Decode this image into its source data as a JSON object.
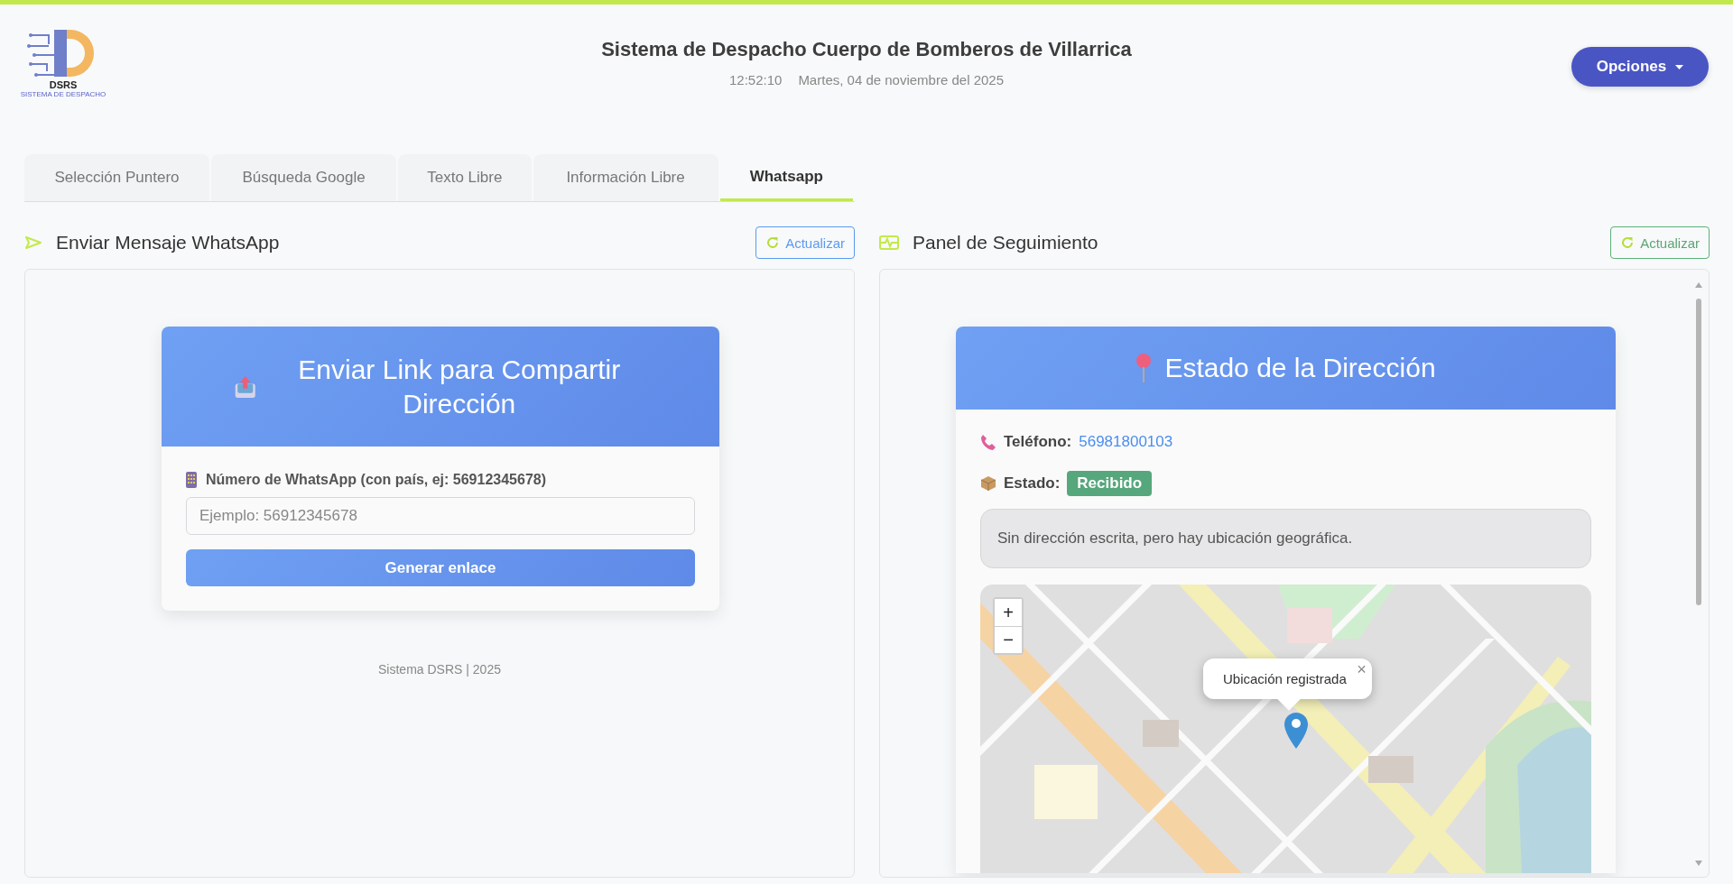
{
  "header": {
    "logo_text": "DSRS",
    "logo_subtitle": "SISTEMA DE DESPACHO",
    "title": "Sistema de Despacho Cuerpo de Bomberos de Villarrica",
    "time": "12:52:10",
    "date": "Martes, 04 de noviembre del 2025",
    "menu_button": "Opciones"
  },
  "tabs": [
    {
      "label": "Selección Puntero",
      "selected": false
    },
    {
      "label": "Búsqueda Google",
      "selected": false
    },
    {
      "label": "Texto Libre",
      "selected": false
    },
    {
      "label": "Información Libre",
      "selected": false
    },
    {
      "label": "Whatsapp",
      "selected": true
    }
  ],
  "send_panel": {
    "title": "Enviar Mensaje WhatsApp",
    "refresh_button": "Actualizar",
    "card": {
      "title": "Enviar Link para Compartir Dirección",
      "field_label": "Número de WhatsApp (con país, ej: 56912345678)",
      "placeholder": "Ejemplo: 56912345678",
      "submit_button": "Generar enlace"
    },
    "footer": "Sistema DSRS | 2025"
  },
  "tracking_panel": {
    "title": "Panel de Seguimiento",
    "refresh_button": "Actualizar",
    "card": {
      "title": "Estado de la Dirección",
      "phone_label": "Teléfono:",
      "phone": "56981800103",
      "status_label": "Estado:",
      "status": "Recibido",
      "note": "Sin dirección escrita, pero hay ubicación geográfica.",
      "map": {
        "kind": "picture",
        "zoom_in": "+",
        "zoom_out": "−",
        "popup": "Ubicación registrada",
        "popup_close": "×"
      }
    }
  }
}
